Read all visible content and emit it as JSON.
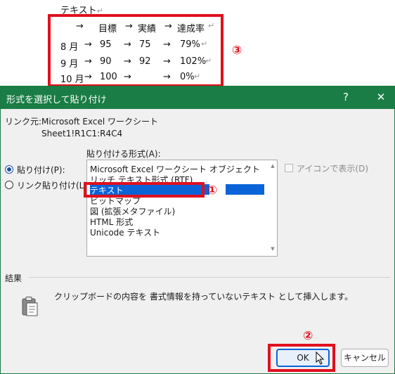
{
  "document": {
    "heading": "テキスト",
    "para_mark": "↵",
    "table": {
      "header": [
        "→",
        "目標",
        "→",
        "実績",
        "→",
        "達成率"
      ],
      "rows": [
        {
          "month": "8 月",
          "a1": "→",
          "target": "95",
          "a2": "→",
          "actual": "75",
          "a3": "→",
          "rate": "79%"
        },
        {
          "month": "9 月",
          "a1": "→",
          "target": "90",
          "a2": "→",
          "actual": "92",
          "a3": "→",
          "rate": "102%"
        },
        {
          "month": "10 月",
          "a1": "→",
          "target": "100",
          "a2": "→",
          "actual": "",
          "a3": "→",
          "rate": "0%"
        }
      ]
    },
    "annotation_3": "③"
  },
  "dialog": {
    "title": "形式を選択して貼り付け",
    "help_button": "?",
    "close_button": "✕",
    "link_source_label": "リンク元:",
    "link_source_app": "Microsoft Excel ワークシート",
    "link_source_range": "Sheet1!R1C1:R4C4",
    "paste_as_label": "貼り付ける形式(A):",
    "radio_paste": "貼り付け(P):",
    "radio_paste_link": "リンク貼り付け(L):",
    "formats": [
      "Microsoft Excel ワークシート オブジェクト",
      "リッチ テキスト形式 (RTF)",
      "テキスト",
      "ビットマップ",
      "図 (拡張メタファイル)",
      "HTML 形式",
      "Unicode テキスト"
    ],
    "selected_format": "テキスト",
    "display_as_icon": "アイコンで表示(D)",
    "result_label": "結果",
    "result_description": "クリップボードの内容を 書式情報を持っていないテキスト として挿入します。",
    "ok_button": "OK",
    "cancel_button": "キャンセル",
    "annotation_1": "①",
    "annotation_2": "②"
  },
  "colors": {
    "title_bar": "#1a7d45",
    "selection": "#0a64d8",
    "annotation_red": "#e0101e"
  },
  "icons": [
    "clipboard-icon",
    "scroll-up-icon",
    "scroll-down-icon",
    "mouse-cursor-icon"
  ]
}
